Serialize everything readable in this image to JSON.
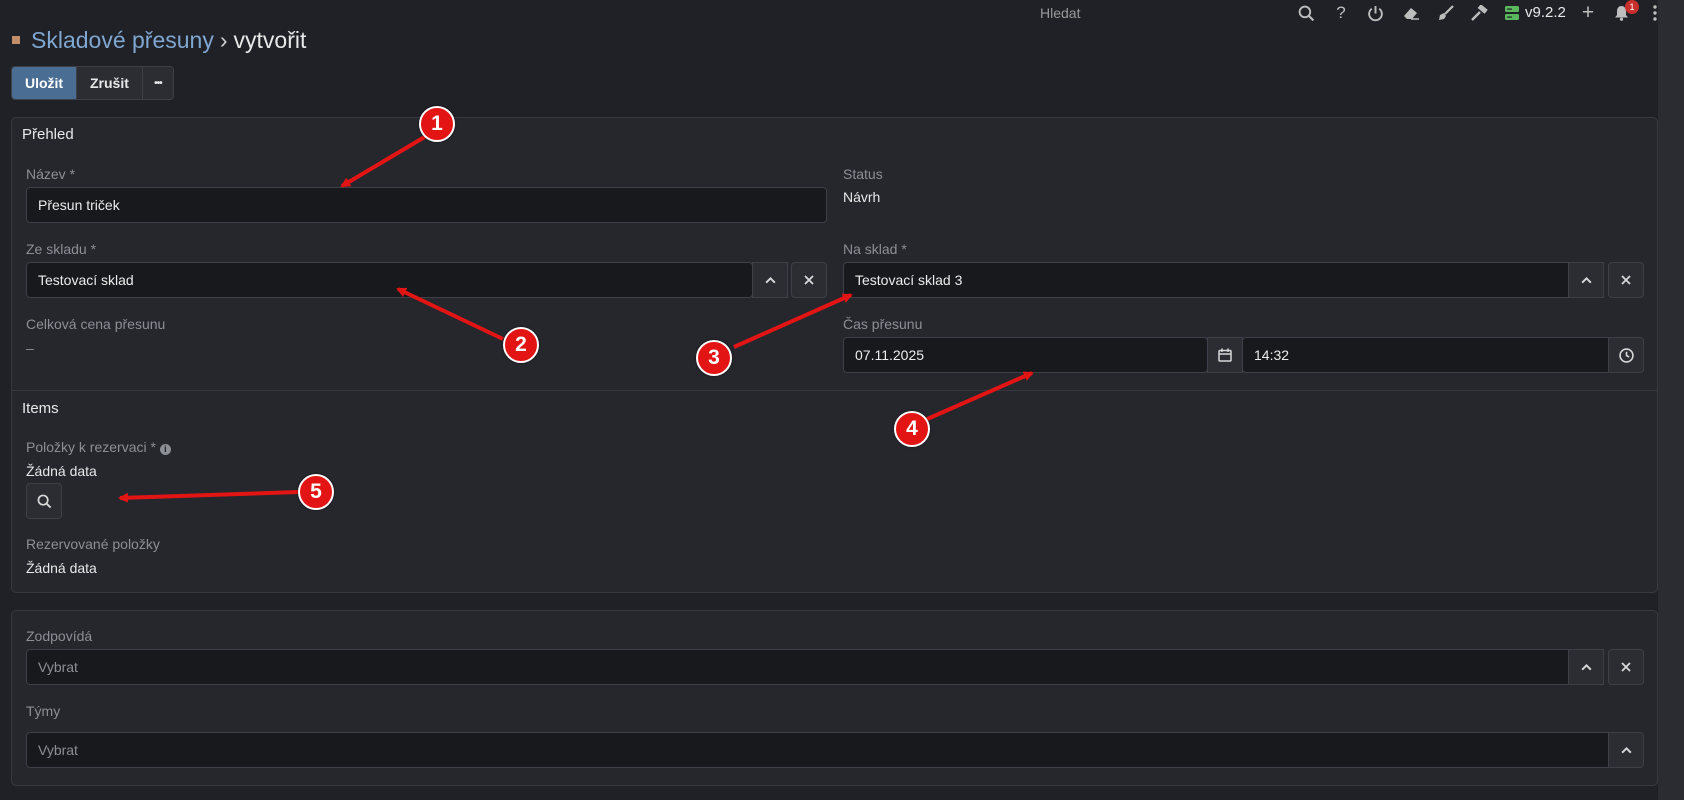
{
  "topbar": {
    "search_label": "Hledat",
    "version": "v9.2.2",
    "notification_count": "1",
    "icons": [
      "search-icon",
      "help-icon",
      "power-icon",
      "eraser-icon",
      "brush-icon",
      "hammer-icon",
      "server-icon",
      "plus-icon",
      "bell-icon",
      "kebab-icon"
    ]
  },
  "breadcrumb": {
    "parent": "Skladové přesuny",
    "separator": "›",
    "current": "vytvořit"
  },
  "actions": {
    "save_label": "Uložit",
    "cancel_label": "Zrušit",
    "more_label": "•••"
  },
  "overview": {
    "title": "Přehled",
    "name": {
      "label": "Název *",
      "value": "Přesun triček"
    },
    "status": {
      "label": "Status",
      "value": "Návrh"
    },
    "from_warehouse": {
      "label": "Ze skladu *",
      "value": "Testovací sklad"
    },
    "to_warehouse": {
      "label": "Na sklad *",
      "value": "Testovací sklad 3"
    },
    "total_price": {
      "label": "Celková cena přesunu",
      "value": "–"
    },
    "transfer_time": {
      "label": "Čas přesunu",
      "date": "07.11.2025",
      "time": "14:32"
    }
  },
  "items": {
    "title": "Items",
    "reserve_label": "Položky k rezervaci *",
    "reserve_empty": "Žádná data",
    "reserved_label": "Rezervované položky",
    "reserved_empty": "Žádná data"
  },
  "assignment": {
    "responsible": {
      "label": "Zodpovídá",
      "placeholder": "Vybrat"
    },
    "teams": {
      "label": "Týmy",
      "placeholder": "Vybrat"
    }
  },
  "annotations": [
    "1",
    "2",
    "3",
    "4",
    "5"
  ],
  "colors": {
    "accent": "#4a6e93",
    "link": "#7fa7d1",
    "annotation": "#e31414",
    "background": "#1f2126"
  }
}
